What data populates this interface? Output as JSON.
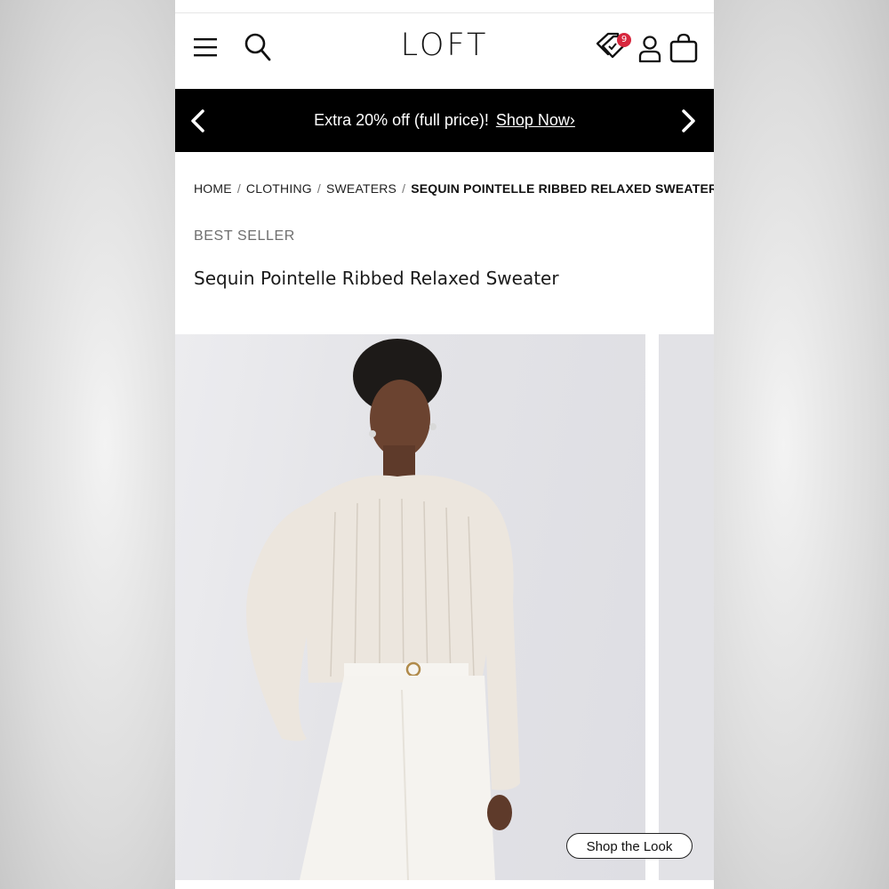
{
  "header": {
    "logo": "LOFT",
    "wishlist_count": "9",
    "icons": [
      "menu-icon",
      "search-icon",
      "wishlist-tag-icon",
      "account-icon",
      "shopping-bag-icon"
    ]
  },
  "promo": {
    "text": "Extra 20% off (full price)!",
    "link": "Shop Now›",
    "prev_icon": "chevron-left-icon",
    "next_icon": "chevron-right-icon"
  },
  "breadcrumb": {
    "home": "HOME",
    "clothing": "CLOTHING",
    "sweaters": "SWEATERS",
    "current": "SEQUIN POINTELLE RIBBED RELAXED SWEATER",
    "separator": "/"
  },
  "product": {
    "badge": "BEST SELLER",
    "title": "Sequin Pointelle Ribbed Relaxed Sweater"
  },
  "gallery": {
    "shop_the_look": "Shop the Look"
  },
  "colors": {
    "promo_bg": "#000000",
    "badge_red": "#d7263d",
    "text": "#111111"
  }
}
